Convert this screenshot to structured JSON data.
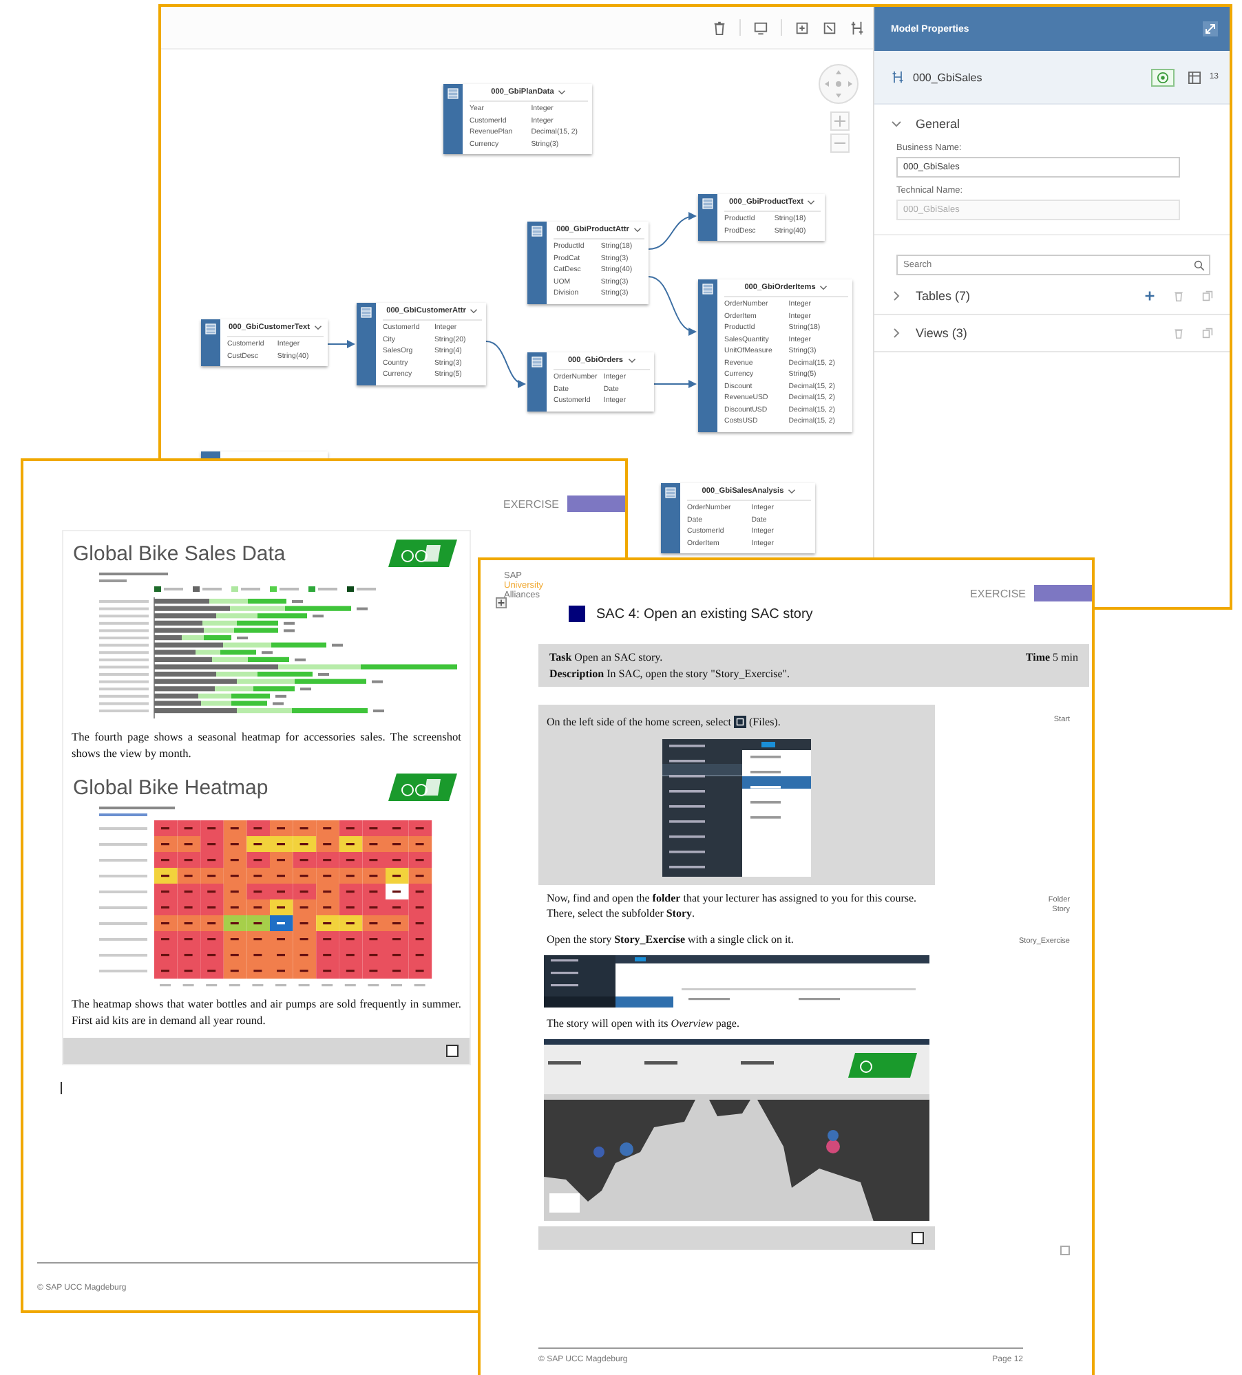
{
  "modeler": {
    "nodes": [
      {
        "title": "000_GbiPlanData",
        "fields": [
          {
            "name": "Year",
            "type": "Integer"
          },
          {
            "name": "CustomerId",
            "type": "Integer"
          },
          {
            "name": "RevenuePlan",
            "type": "Decimal(15, 2)"
          },
          {
            "name": "Currency",
            "type": "String(3)"
          }
        ]
      },
      {
        "title": "000_GbiProductText",
        "fields": [
          {
            "name": "ProductId",
            "type": "String(18)"
          },
          {
            "name": "ProdDesc",
            "type": "String(40)"
          }
        ]
      },
      {
        "title": "000_GbiProductAttr",
        "fields": [
          {
            "name": "ProductId",
            "type": "String(18)"
          },
          {
            "name": "ProdCat",
            "type": "String(3)"
          },
          {
            "name": "CatDesc",
            "type": "String(40)"
          },
          {
            "name": "UOM",
            "type": "String(3)"
          },
          {
            "name": "Division",
            "type": "String(3)"
          }
        ]
      },
      {
        "title": "000_GbiOrderItems",
        "fields": [
          {
            "name": "OrderNumber",
            "type": "Integer"
          },
          {
            "name": "OrderItem",
            "type": "Integer"
          },
          {
            "name": "ProductId",
            "type": "String(18)"
          },
          {
            "name": "SalesQuantity",
            "type": "Integer"
          },
          {
            "name": "UnitOfMeasure",
            "type": "String(3)"
          },
          {
            "name": "Revenue",
            "type": "Decimal(15, 2)"
          },
          {
            "name": "Currency",
            "type": "String(5)"
          },
          {
            "name": "Discount",
            "type": "Decimal(15, 2)"
          },
          {
            "name": "RevenueUSD",
            "type": "Decimal(15, 2)"
          },
          {
            "name": "DiscountUSD",
            "type": "Decimal(15, 2)"
          },
          {
            "name": "CostsUSD",
            "type": "Decimal(15, 2)"
          }
        ]
      },
      {
        "title": "000_GbiCustomerText",
        "fields": [
          {
            "name": "CustomerId",
            "type": "Integer"
          },
          {
            "name": "CustDesc",
            "type": "String(40)"
          }
        ]
      },
      {
        "title": "000_GbiCustomerAttr",
        "fields": [
          {
            "name": "CustomerId",
            "type": "Integer"
          },
          {
            "name": "City",
            "type": "String(20)"
          },
          {
            "name": "SalesOrg",
            "type": "String(4)"
          },
          {
            "name": "Country",
            "type": "String(3)"
          },
          {
            "name": "Currency",
            "type": "String(5)"
          }
        ]
      },
      {
        "title": "000_GbiOrders",
        "fields": [
          {
            "name": "OrderNumber",
            "type": "Integer"
          },
          {
            "name": "Date",
            "type": "Date"
          },
          {
            "name": "CustomerId",
            "type": "Integer"
          }
        ]
      },
      {
        "title": "000_GbiSalesAnalysis",
        "fields": [
          {
            "name": "OrderNumber",
            "type": "Integer"
          },
          {
            "name": "Date",
            "type": "Date"
          },
          {
            "name": "CustomerId",
            "type": "Integer"
          },
          {
            "name": "OrderItem",
            "type": "Integer"
          }
        ]
      }
    ],
    "properties": {
      "title": "Model Properties",
      "model_name": "000_GbiSales",
      "count": "13",
      "general": {
        "label": "General",
        "expanded": true
      },
      "business_name_label": "Business Name:",
      "business_name": "000_GbiSales",
      "technical_name_label": "Technical Name:",
      "technical_name": "000_GbiSales",
      "search": {
        "placeholder": "Search"
      },
      "groups": [
        {
          "label": "Tables (7)",
          "expanded": false,
          "can_add": true
        },
        {
          "label": "Views (3)",
          "expanded": false,
          "can_add": false
        }
      ]
    }
  },
  "exercise_page": {
    "label": "EXERCISE",
    "sections": [
      {
        "title": "Global Bike Sales Data",
        "kind": "bar_chart",
        "text": "The fourth page shows a seasonal heatmap for accessories sales. The screenshot shows the view by month."
      },
      {
        "title": "Global Bike Heatmap",
        "kind": "heatmap",
        "text": "The heatmap shows that water bottles and air pumps are sold frequently in summer. First aid kits are in demand all year round."
      }
    ],
    "checked": false,
    "footer": "© SAP UCC Magdeburg"
  },
  "story_page": {
    "brand": [
      "SAP",
      "University",
      "Alliances"
    ],
    "label": "EXERCISE",
    "title": "SAC 4: Open an existing SAC story",
    "task": "**Task** Open an SAC story.",
    "time": "**Time** 5 min",
    "description": "**Description** In SAC, open the story \"Story_Exercise\".",
    "blocks": [
      {
        "kind": "icon_text",
        "before": "On the left side of the home screen, select",
        "after": "(Files).",
        "note_lines": [
          "Start"
        ],
        "shaded": true
      },
      {
        "kind": "menu_screenshot",
        "shaded": true
      },
      {
        "kind": "text",
        "text": "Now, find and open the **folder** that your lecturer has assigned to you for this course. There, select the subfolder **Story**.",
        "note_lines": [
          "Folder",
          "Story"
        ],
        "shaded": false
      },
      {
        "kind": "text",
        "text": "Open the story **Story_Exercise** with a single click on it.",
        "note_lines": [
          "Story_Exercise"
        ],
        "shaded": false
      },
      {
        "kind": "files_screenshot",
        "shaded": false
      },
      {
        "kind": "text",
        "text": "The story will open with its *Overview* page.",
        "shaded": false
      },
      {
        "kind": "map_screenshot",
        "shaded": false
      }
    ],
    "checked": false,
    "side_checked": false,
    "footer": "© SAP UCC Magdeburg",
    "page": "Page 12"
  }
}
